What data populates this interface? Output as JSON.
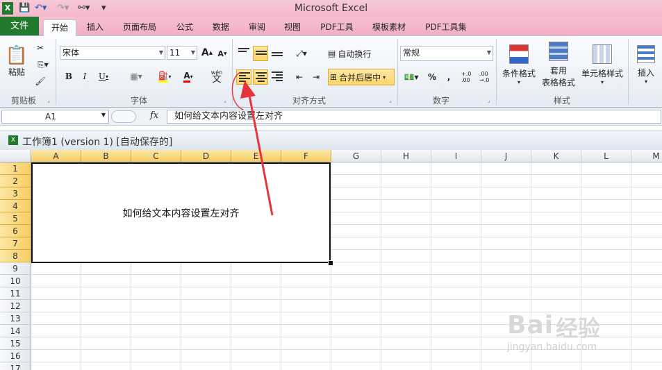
{
  "window": {
    "title": "Microsoft Excel"
  },
  "tabs": [
    {
      "label": "文件"
    },
    {
      "label": "开始"
    },
    {
      "label": "插入"
    },
    {
      "label": "页面布局"
    },
    {
      "label": "公式"
    },
    {
      "label": "数据"
    },
    {
      "label": "审阅"
    },
    {
      "label": "视图"
    },
    {
      "label": "PDF工具"
    },
    {
      "label": "模板素材"
    },
    {
      "label": "PDF工具集"
    }
  ],
  "ribbon": {
    "clipboard": {
      "label": "剪贴板",
      "paste": "粘贴"
    },
    "font": {
      "label": "字体",
      "name": "宋体",
      "size": "11",
      "bold": "B",
      "italic": "I",
      "underline": "U",
      "grow": "A",
      "shrink": "A",
      "color": "A",
      "wen": "wén",
      "wen_char": "文"
    },
    "alignment": {
      "label": "对齐方式",
      "wrap": "自动换行",
      "merge": "合并后居中"
    },
    "number": {
      "label": "数字",
      "format": "常规",
      "percent": "%",
      "comma": ",",
      "inc": "+.0 .00",
      "dec": ".00 →.0"
    },
    "styles": {
      "label": "样式",
      "cond": "条件格式",
      "table1": "套用",
      "table2": "表格格式",
      "cell": "单元格样式"
    },
    "cells": {
      "insert": "插入"
    }
  },
  "formula_bar": {
    "name_box": "A1",
    "fx": "fx",
    "content": "如何给文本内容设置左对齐"
  },
  "workbook": {
    "title": "工作簿1 (version 1) [自动保存的]"
  },
  "columns": [
    "A",
    "B",
    "C",
    "D",
    "E",
    "F",
    "G",
    "H",
    "I",
    "J",
    "K",
    "L",
    "M"
  ],
  "rows": [
    "1",
    "2",
    "3",
    "4",
    "5",
    "6",
    "7",
    "8",
    "9",
    "10",
    "11",
    "12",
    "13",
    "14",
    "15",
    "16",
    "17"
  ],
  "cell_text": "如何给文本内容设置左对齐",
  "watermark": {
    "brand": "Bai",
    "brand2": "经验",
    "url": "jingyan.baidu.com"
  },
  "colors": {
    "annotation": "#e8333a",
    "highlight": "#fbd66b",
    "file_tab": "#217a2e"
  }
}
